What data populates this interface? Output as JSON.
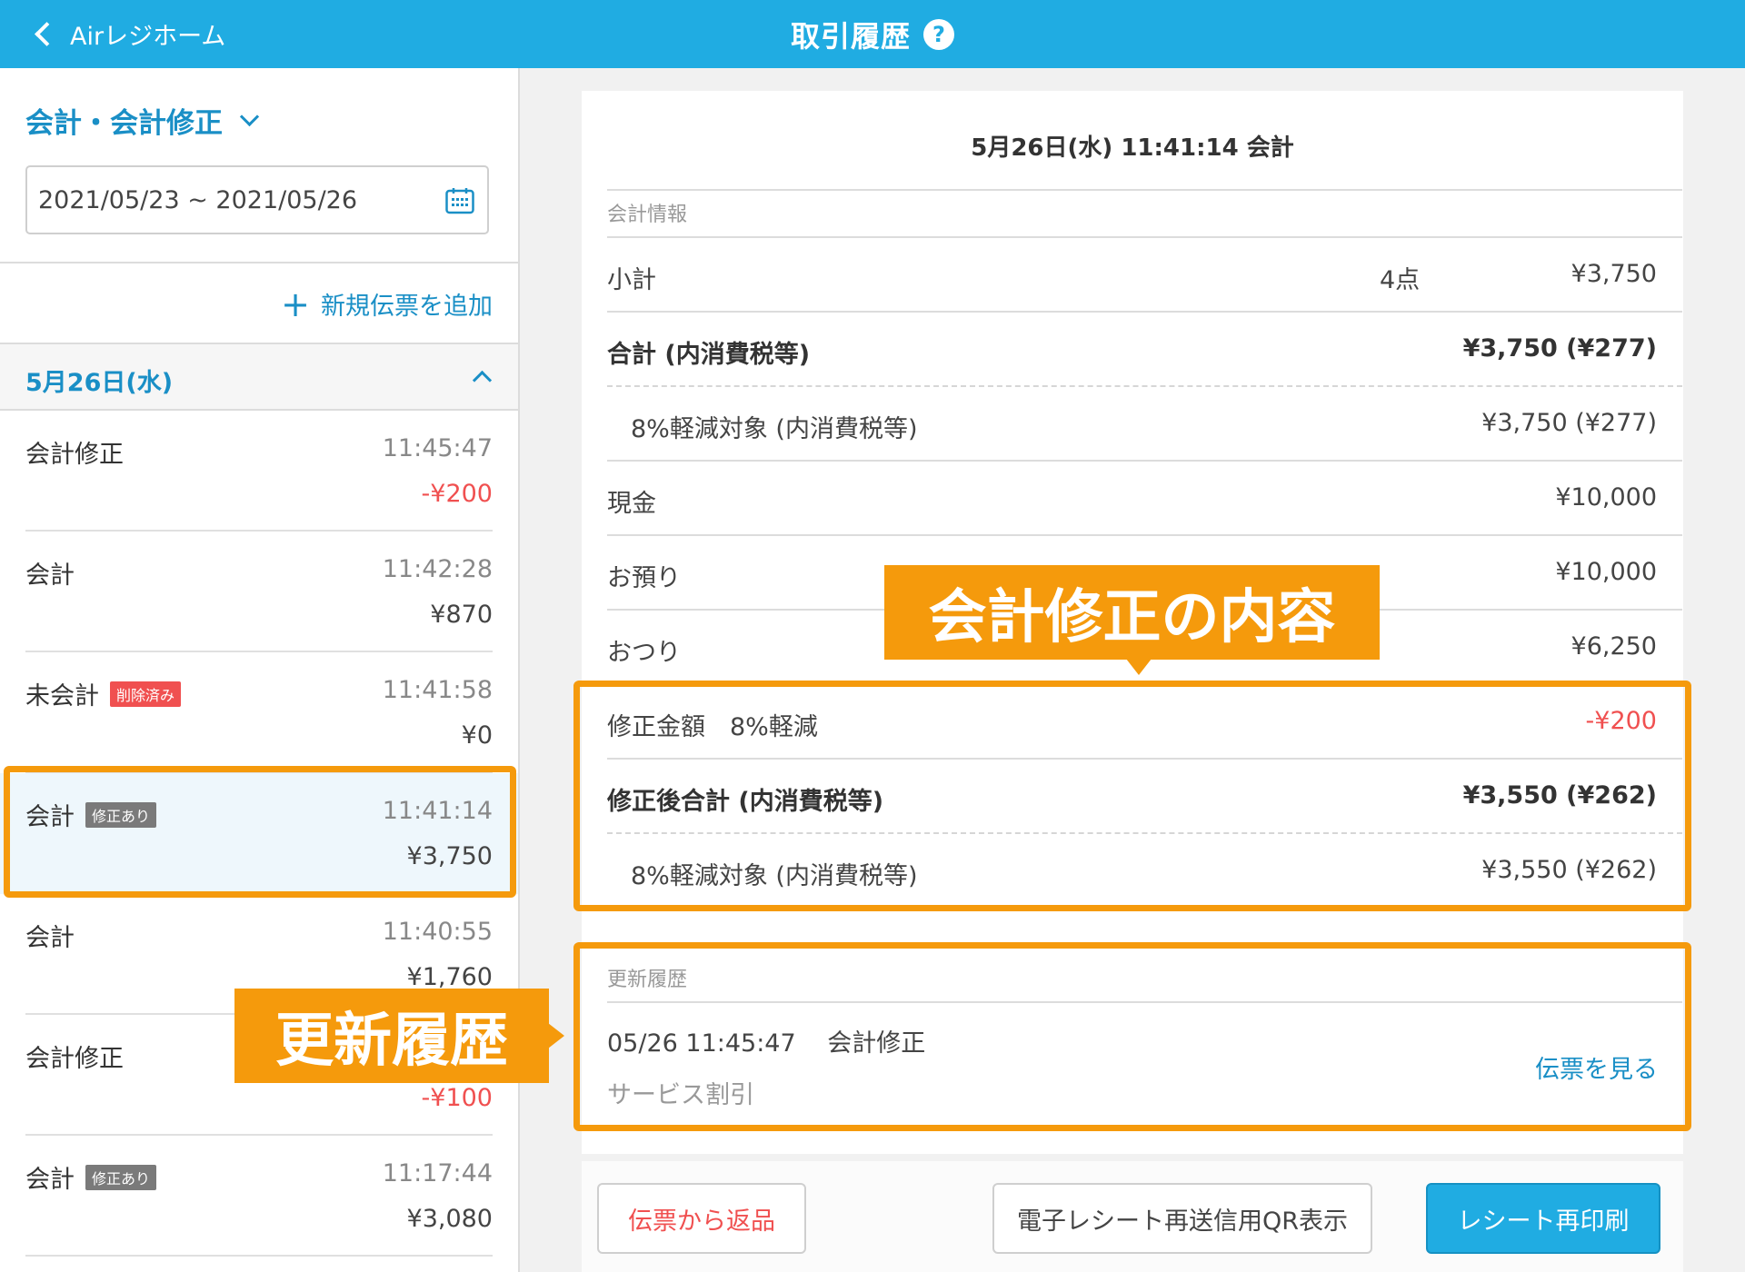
{
  "header": {
    "back_label": "Airレジホーム",
    "title": "取引履歴",
    "help": "?"
  },
  "sidebar": {
    "filter_label": "会計・会計修正",
    "date_range": "2021/05/23 ~ 2021/05/26",
    "add_label": "新規伝票を追加",
    "date_group": "5月26日(水)",
    "transactions": [
      {
        "type": "会計修正",
        "time": "11:45:47",
        "amount": "-¥200"
      },
      {
        "type": "会計",
        "time": "11:42:28",
        "amount": "¥870"
      },
      {
        "type": "未会計",
        "badge": "削除済み",
        "time": "11:41:58",
        "amount": "¥0"
      },
      {
        "type": "会計",
        "badge": "修正あり",
        "time": "11:41:14",
        "amount": "¥3,750"
      },
      {
        "type": "会計",
        "time": "11:40:55",
        "amount": "¥1,760"
      },
      {
        "type": "会計修正",
        "time": "",
        "amount": "-¥100"
      },
      {
        "type": "会計",
        "badge": "修正あり",
        "time": "11:17:44",
        "amount": "¥3,080"
      }
    ]
  },
  "detail": {
    "title": "5月26日(水) 11:41:14 会計",
    "info_label": "会計情報",
    "subtotal": {
      "label": "小計",
      "count": "4点",
      "value": "¥3,750"
    },
    "total": {
      "label": "合計 (内消費税等)",
      "value": "¥3,750 (¥277)"
    },
    "reduced": {
      "label": "8%軽減対象 (内消費税等)",
      "value": "¥3,750 (¥277)"
    },
    "cash": {
      "label": "現金",
      "value": "¥10,000"
    },
    "deposit": {
      "label": "お預り",
      "value": "¥10,000"
    },
    "change": {
      "label": "おつり",
      "value": "¥6,250"
    },
    "correction": {
      "label": "修正金額　8%軽減",
      "value": "-¥200"
    },
    "corrected_total": {
      "label": "修正後合計 (内消費税等)",
      "value": "¥3,550 (¥262)"
    },
    "corrected_reduced": {
      "label": "8%軽減対象 (内消費税等)",
      "value": "¥3,550 (¥262)"
    },
    "history_label": "更新履歴",
    "history": {
      "datetime": "05/26 11:45:47",
      "type": "会計修正",
      "note": "サービス割引",
      "link": "伝票を見る"
    }
  },
  "buttons": {
    "return": "伝票から返品",
    "qr": "電子レシート再送信用QR表示",
    "print": "レシート再印刷"
  },
  "annotations": {
    "correction_content": "会計修正の内容",
    "update_history": "更新履歴"
  },
  "colors": {
    "header": "#20ace2",
    "link": "#1a8fc6",
    "negative": "#f05050",
    "annotation": "#f59a0c"
  }
}
